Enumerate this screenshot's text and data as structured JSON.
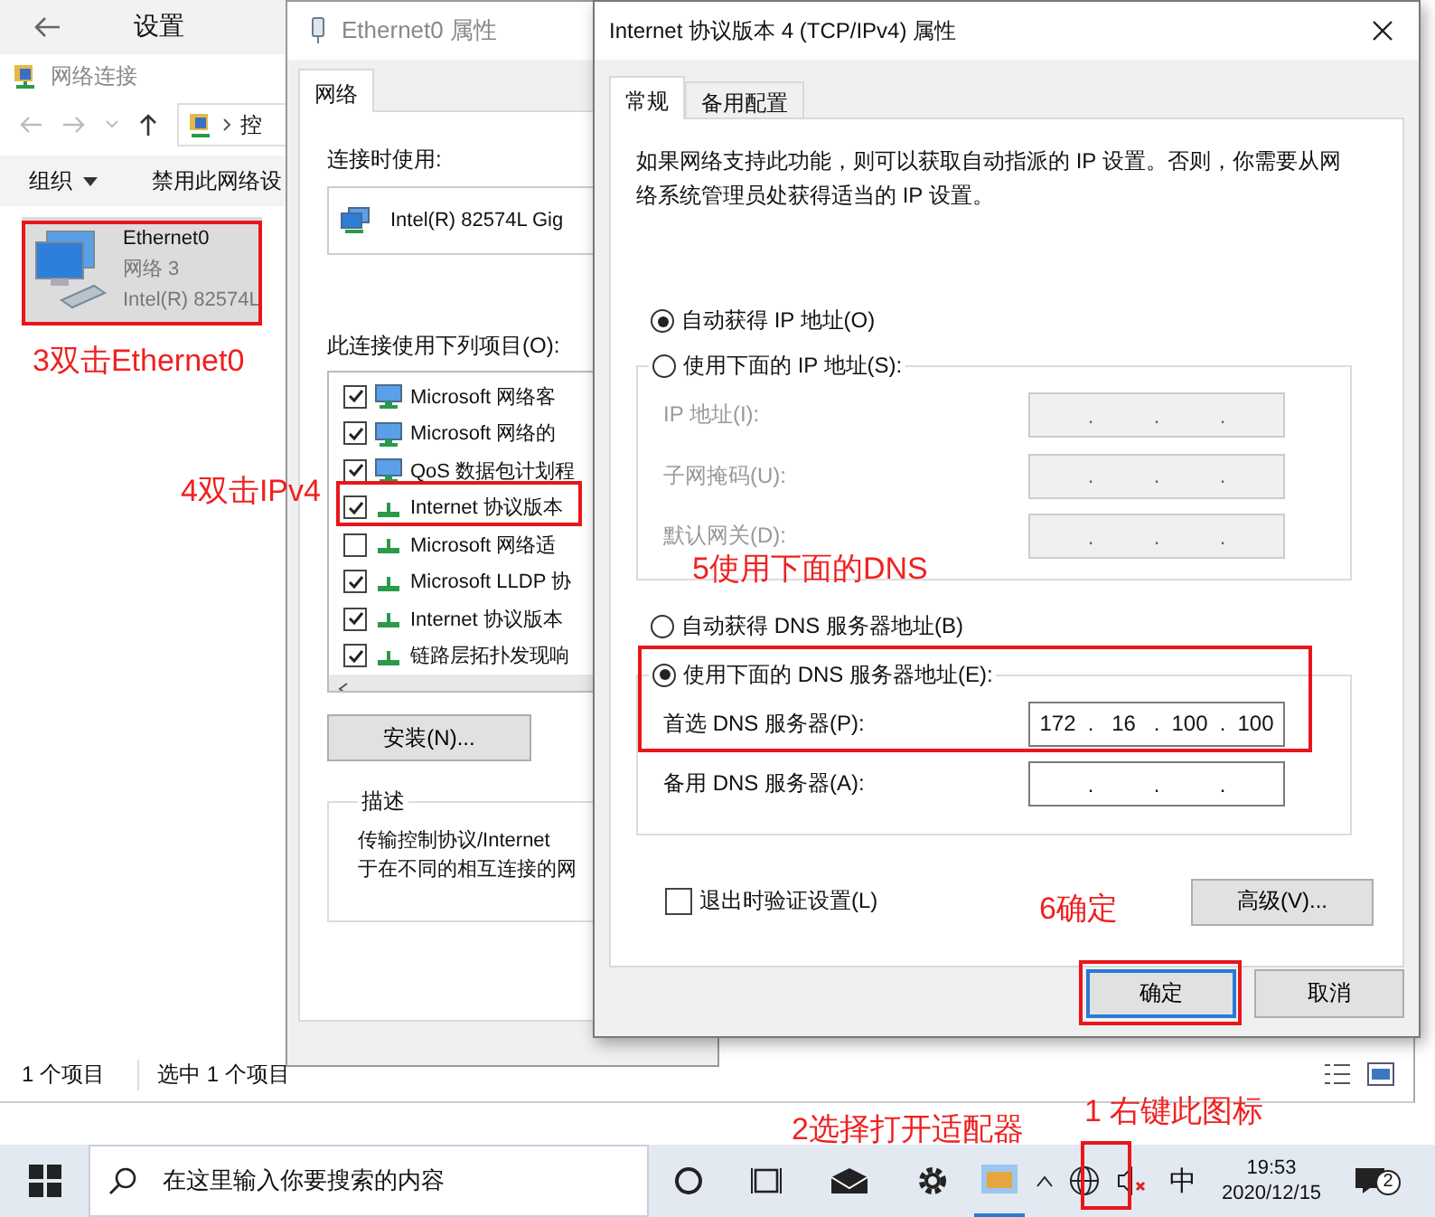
{
  "explorer": {
    "header_title": "设置",
    "window_title": "网络连接",
    "address": "控",
    "toolbar": [
      {
        "label": "组织",
        "dropdown": true
      },
      {
        "label": "禁用此网络设",
        "dropdown": false
      }
    ],
    "item": {
      "name": "Ethernet0",
      "network": "网络 3",
      "adapter": "Intel(R) 82574L",
      "selected": true
    },
    "status_bar": [
      "1 个项目",
      "选中 1 个项目"
    ]
  },
  "adapter_properties": {
    "title": "Ethernet0 属性",
    "tabs": [
      {
        "label": "网络",
        "selected": true
      }
    ],
    "connect_using_label": "连接时使用:",
    "adapter": "Intel(R) 82574L Gig",
    "items_label": "此连接使用下列项目(O):",
    "items": [
      {
        "label": "Microsoft 网络客",
        "checked": true,
        "kind": "service"
      },
      {
        "label": "Microsoft 网络的",
        "checked": true,
        "kind": "service"
      },
      {
        "label": "QoS 数据包计划程",
        "checked": true,
        "kind": "service"
      },
      {
        "label": "Internet 协议版本",
        "checked": true,
        "kind": "protocol"
      },
      {
        "label": "Microsoft 网络适",
        "checked": false,
        "kind": "protocol"
      },
      {
        "label": "Microsoft LLDP 协",
        "checked": true,
        "kind": "protocol"
      },
      {
        "label": "Internet 协议版本",
        "checked": true,
        "kind": "protocol"
      },
      {
        "label": "链路层拓扑发现响",
        "checked": true,
        "kind": "protocol"
      }
    ],
    "buttons": [
      "安装(N)..."
    ],
    "description_label": "描述",
    "description_lines": [
      "传输控制协议/Internet",
      "于在不同的相互连接的网"
    ]
  },
  "ipv4_dialog": {
    "title": "Internet 协议版本 4 (TCP/IPv4) 属性",
    "tabs": [
      {
        "label": "常规",
        "selected": true
      },
      {
        "label": "备用配置",
        "selected": false
      }
    ],
    "intro": "如果网络支持此功能，则可以获取自动指派的 IP 设置。否则，你需要从网络系统管理员处获得适当的 IP 设置。",
    "separator": ".",
    "ip_options": [
      {
        "label": "自动获得 IP 地址(O)",
        "selected": true
      },
      {
        "label": "使用下面的 IP 地址(S):",
        "selected": false
      }
    ],
    "ip_fields": [
      {
        "label": "IP 地址(I):",
        "disabled": true
      },
      {
        "label": "子网掩码(U):",
        "disabled": true
      },
      {
        "label": "默认网关(D):",
        "disabled": true
      }
    ],
    "dns_options": [
      {
        "label": "自动获得 DNS 服务器地址(B)",
        "selected": false
      },
      {
        "label": "使用下面的 DNS 服务器地址(E):",
        "selected": true
      }
    ],
    "dns_fields": [
      {
        "label": "首选 DNS 服务器(P):",
        "disabled": false,
        "octets": [
          "172",
          "16",
          "100",
          "100"
        ]
      },
      {
        "label": "备用 DNS 服务器(A):",
        "disabled": false
      }
    ],
    "validate": {
      "label": "退出时验证设置(L)",
      "checked": false
    },
    "advanced_button": "高级(V)...",
    "buttons": [
      {
        "label": "确定",
        "default": true
      },
      {
        "label": "取消",
        "default": false
      }
    ]
  },
  "taskbar": {
    "search_placeholder": "在这里输入你要搜索的内容",
    "ime": "中",
    "time": "19:53",
    "date": "2020/12/15",
    "notification_count": "2"
  },
  "annotations": [
    {
      "text": "3双击Ethernet0"
    },
    {
      "text": "4双击IPv4"
    },
    {
      "text": "5使用下面的DNS"
    },
    {
      "text": "6确定"
    },
    {
      "text": "2选择打开适配器"
    },
    {
      "text": "1  右键此图标"
    }
  ]
}
